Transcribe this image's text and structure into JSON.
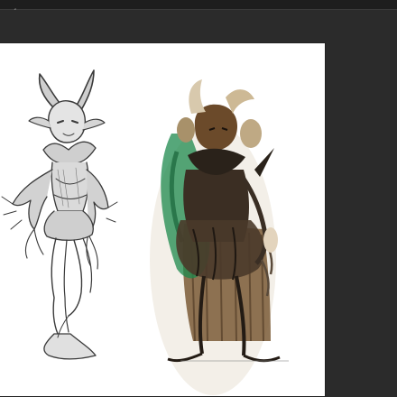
{
  "app": {
    "window_title": "",
    "toolbar_icon": "brush-icon"
  },
  "document": {
    "background_color": "#ffffff",
    "workspace_color": "#2b2b2b",
    "artwork": [
      {
        "id": "pencil-sketch",
        "style": "grayscale line sketch",
        "subject": "horned creature"
      },
      {
        "id": "color-study",
        "style": "painted color study",
        "accent_colors": [
          "#1e8a4e",
          "#6b4a2a",
          "#3a3a3a"
        ]
      }
    ]
  }
}
